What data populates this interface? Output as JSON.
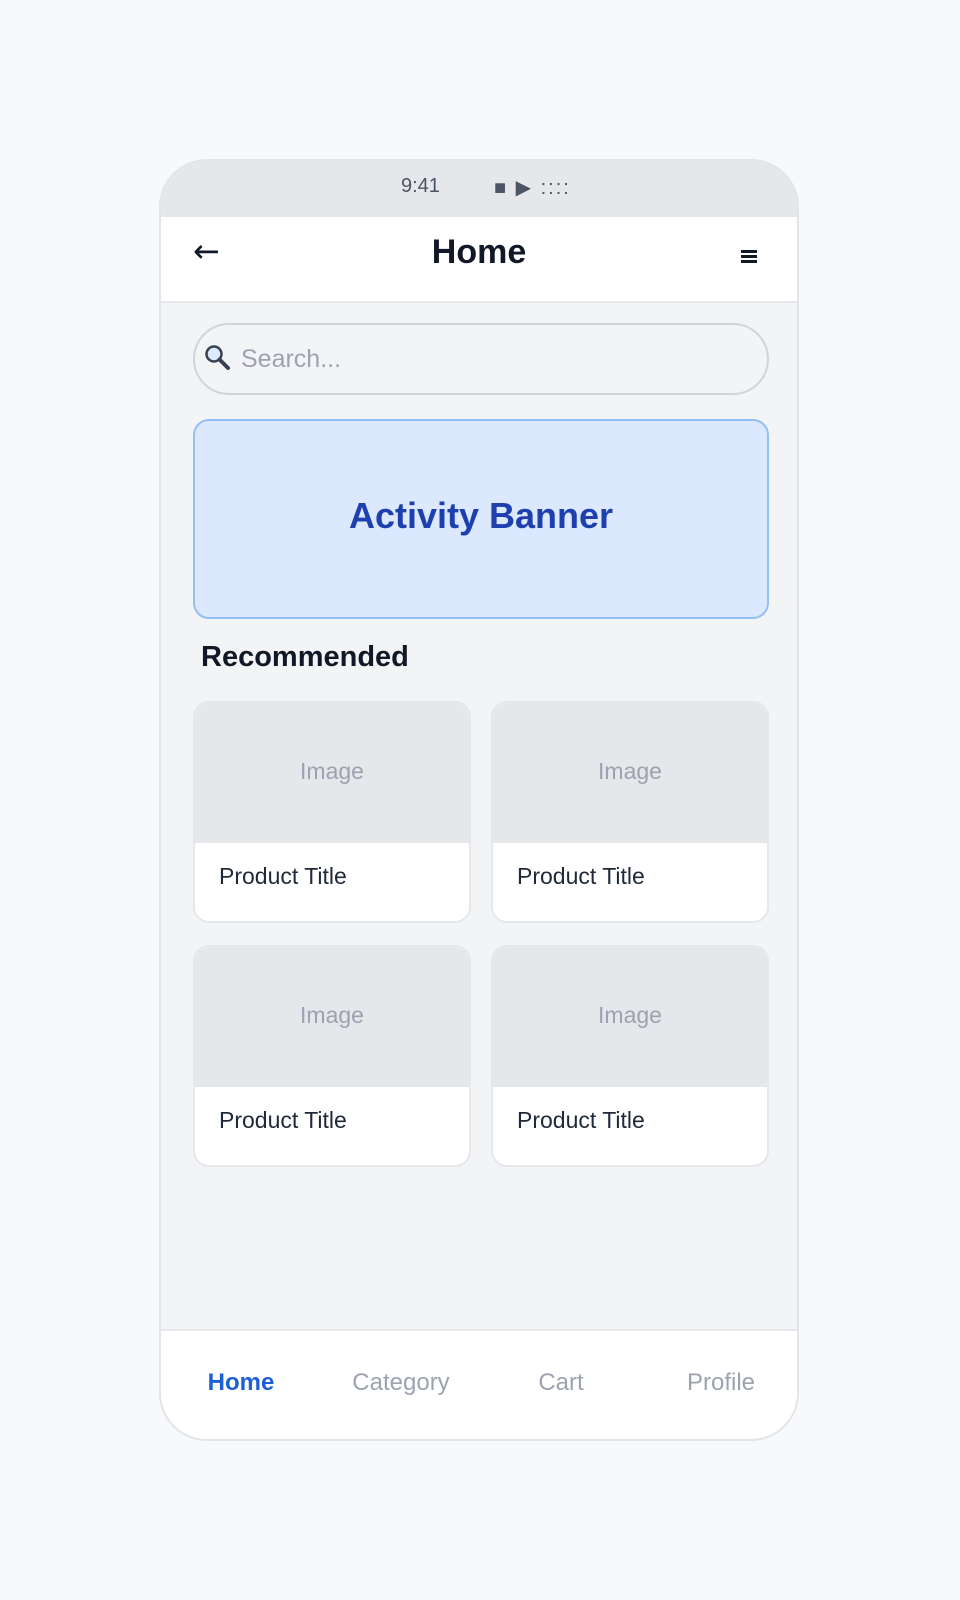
{
  "status_bar": {
    "time": "9:41",
    "icons": "■ ▶ ::::"
  },
  "header": {
    "title": "Home",
    "back_icon": "back-arrow-icon",
    "menu_icon": "hamburger-menu-icon"
  },
  "search": {
    "placeholder": "Search...",
    "value": "",
    "icon": "search-icon"
  },
  "banner": {
    "title": "Activity Banner"
  },
  "recommended": {
    "title": "Recommended",
    "products": [
      {
        "image_label": "Image",
        "title": "Product Title"
      },
      {
        "image_label": "Image",
        "title": "Product Title"
      },
      {
        "image_label": "Image",
        "title": "Product Title"
      },
      {
        "image_label": "Image",
        "title": "Product Title"
      }
    ]
  },
  "tab_bar": {
    "tabs": [
      {
        "label": "Home",
        "active": true
      },
      {
        "label": "Category",
        "active": false
      },
      {
        "label": "Cart",
        "active": false
      },
      {
        "label": "Profile",
        "active": false
      }
    ]
  },
  "colors": {
    "accent": "#1d5fd6",
    "banner_bg": "#dbe8fd",
    "banner_border": "#93c0f2",
    "banner_text": "#1e40af"
  }
}
